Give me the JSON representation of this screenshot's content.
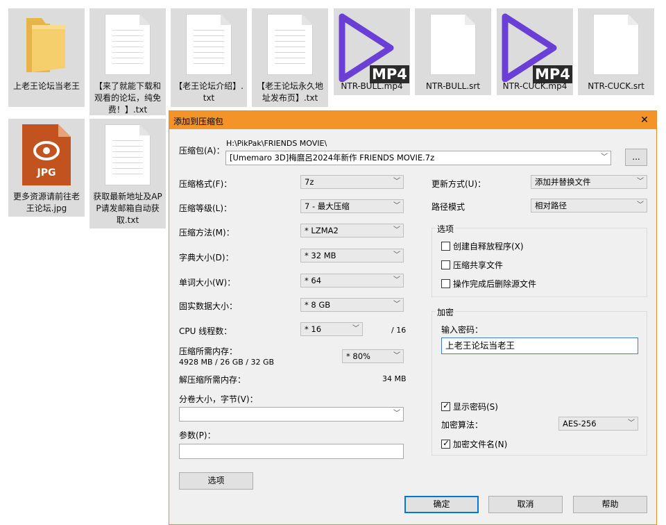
{
  "desktop": {
    "files": [
      {
        "name": "上老王论坛当老王",
        "type": "folder"
      },
      {
        "name": "【来了就能下载和观看的论坛，纯免费！】.txt",
        "type": "text"
      },
      {
        "name": "【老王论坛介绍】.txt",
        "type": "text"
      },
      {
        "name": "【老王论坛永久地址发布页】.txt",
        "type": "text"
      },
      {
        "name": "NTR-BULL.mp4",
        "type": "video",
        "badge": "MP4"
      },
      {
        "name": "NTR-BULL.srt",
        "type": "subtitle"
      },
      {
        "name": "NTR-CUCK.mp4",
        "type": "video",
        "badge": "MP4"
      },
      {
        "name": "NTR-CUCK.srt",
        "type": "subtitle"
      },
      {
        "name": "更多资源请前往老王论坛.jpg",
        "type": "image",
        "badge": "JPG"
      },
      {
        "name": "获取最新地址及APP请发邮箱自动获取.txt",
        "type": "text"
      }
    ]
  },
  "dialog": {
    "title": "添加到压缩包",
    "close": "✕",
    "archive_label": "压缩包(A)：",
    "archive_path": "H:\\PikPak\\FRIENDS MOVIE\\",
    "archive_name": "[Umemaro 3D]梅麿呂2024年新作 FRIENDS MOVIE.7z",
    "browse": "...",
    "format_label": "压缩格式(F)：",
    "format_value": "7z",
    "level_label": "压缩等级(L)：",
    "level_value": "7 - 最大压缩",
    "method_label": "压缩方法(M)：",
    "method_value": "* LZMA2",
    "dict_label": "字典大小(D)：",
    "dict_value": "* 32 MB",
    "word_label": "单词大小(W)：",
    "word_value": "* 64",
    "solid_label": "固实数据大小：",
    "solid_value": "* 8 GB",
    "threads_label": "CPU 线程数：",
    "threads_value": "* 16",
    "threads_total": "/ 16",
    "mem_label": "压缩所需内存：",
    "mem_detail": "4928 MB / 26 GB / 32 GB",
    "mem_value": "* 80%",
    "decomp_label": "解压缩所需内存：",
    "decomp_value": "34 MB",
    "volume_label": "分卷大小，字节(V)：",
    "params_label": "参数(P)：",
    "options_button": "选项",
    "update_label": "更新方式(U)：",
    "update_value": "添加并替换文件",
    "pathmode_label": "路径模式",
    "pathmode_value": "相对路径",
    "options_group": "选项",
    "opt_sfx": "创建自释放程序(X)",
    "opt_shared": "压缩共享文件",
    "opt_delete": "操作完成后删除源文件",
    "encrypt_group": "加密",
    "password_label": "输入密码：",
    "password_value": "上老王论坛当老王",
    "show_password": "显示密码(S)",
    "enc_method_label": "加密算法：",
    "enc_method_value": "AES-256",
    "encrypt_names": "加密文件名(N)",
    "ok": "确定",
    "cancel": "取消",
    "help": "帮助"
  }
}
